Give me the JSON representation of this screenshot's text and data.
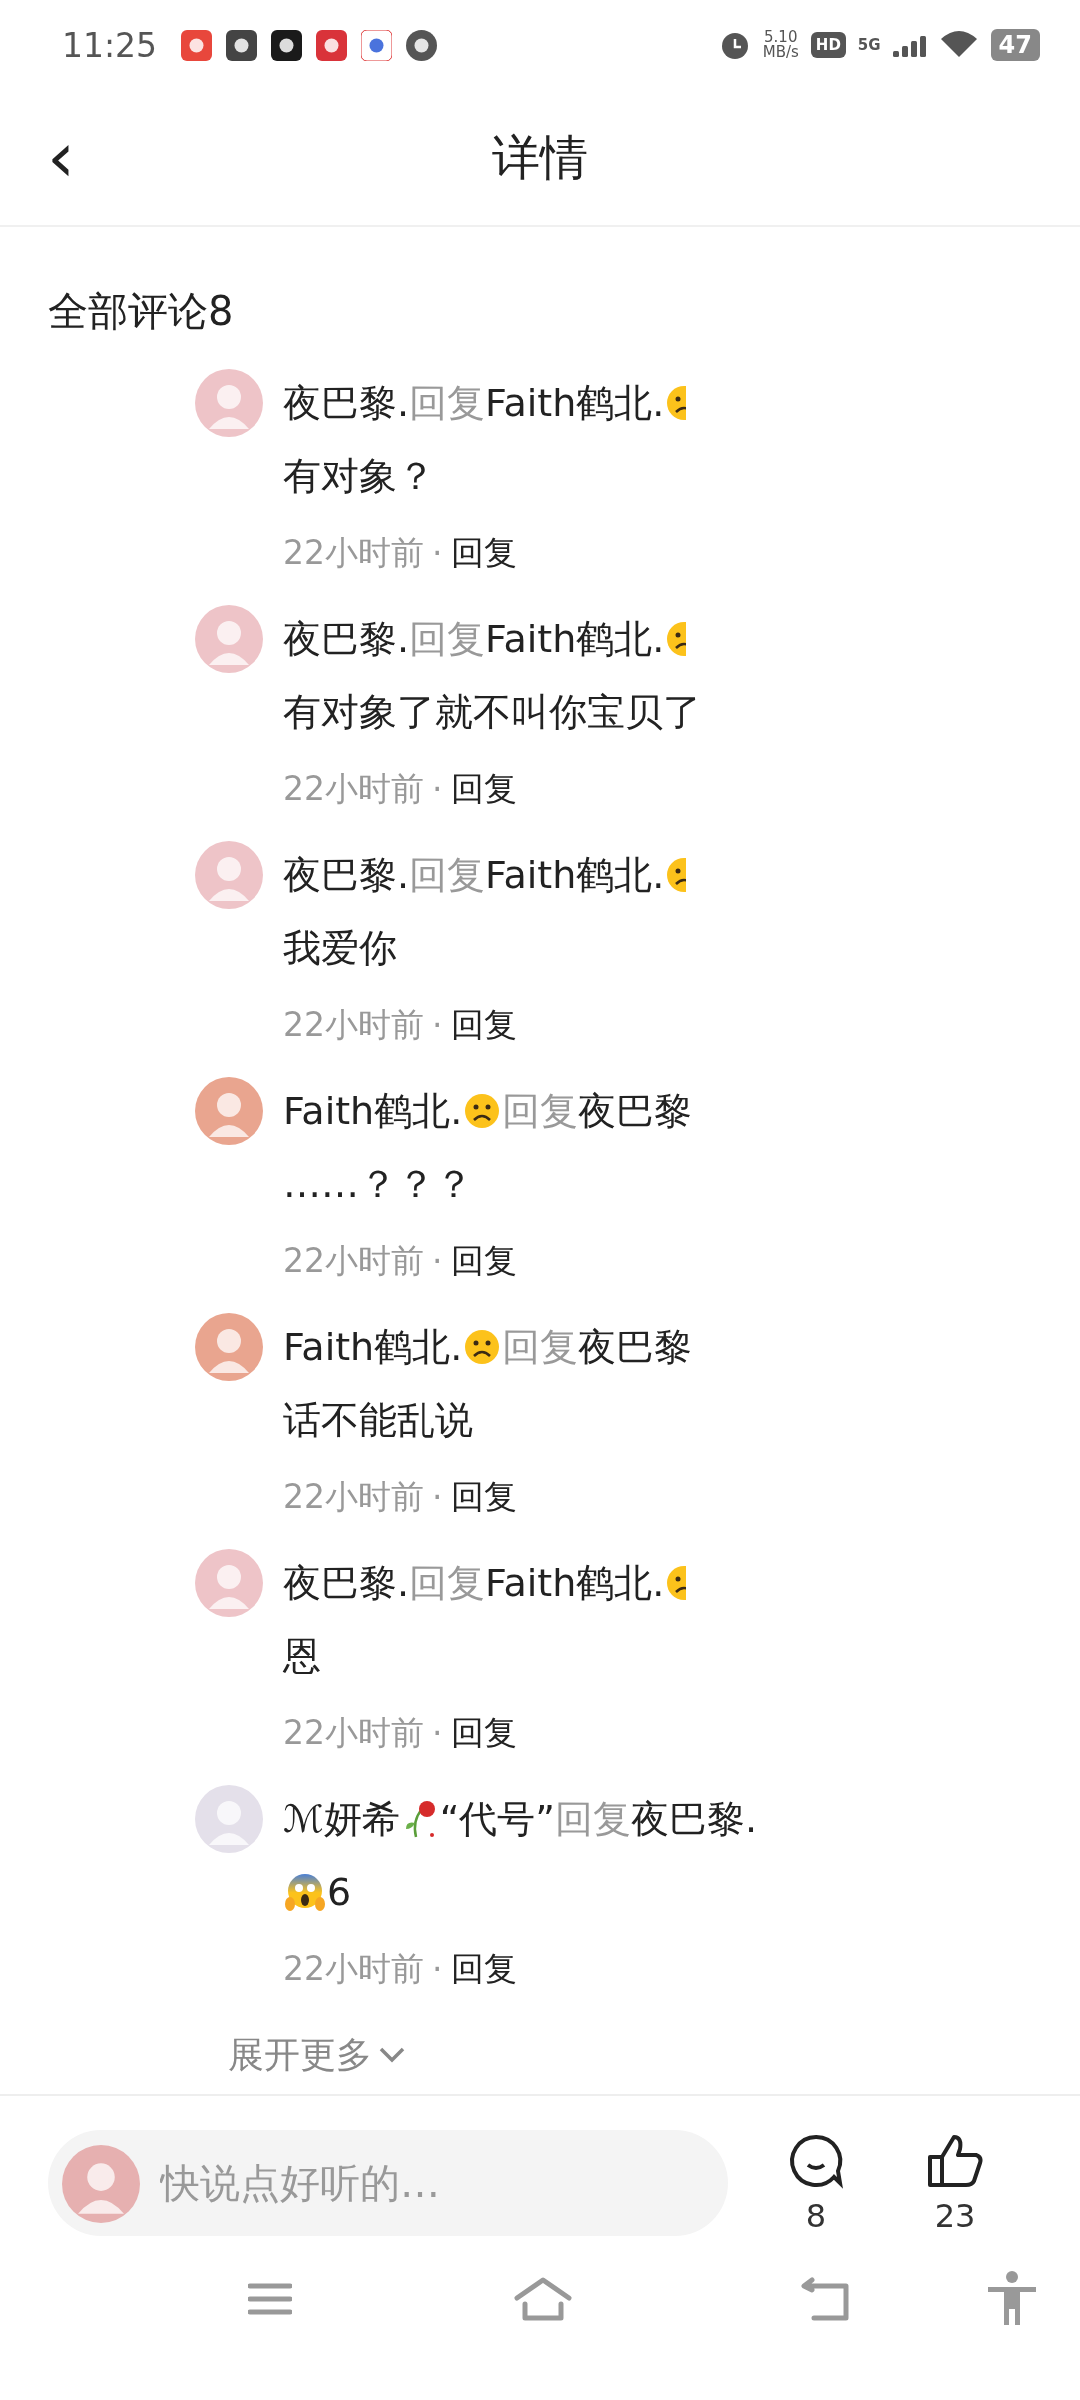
{
  "status_bar": {
    "time": "11:25",
    "speed_value": "5.10",
    "speed_unit": "MB/s",
    "hd": "HD",
    "network": "5G",
    "battery": "47"
  },
  "header": {
    "back": "‹",
    "title": "详情"
  },
  "section_title": "全部评论8",
  "comments": [
    {
      "color": "#eec4c8",
      "name_line": [
        {
          "kind": "name",
          "text": "夜巴黎."
        },
        {
          "kind": "reply",
          "text": "回复"
        },
        {
          "kind": "name",
          "text": "Faith鹤北."
        },
        {
          "kind": "frown-cut"
        }
      ],
      "body": [
        {
          "kind": "name",
          "text": "有对象？"
        }
      ],
      "time": "22小时前",
      "reply": "回复"
    },
    {
      "color": "#eec4c8",
      "name_line": [
        {
          "kind": "name",
          "text": "夜巴黎."
        },
        {
          "kind": "reply",
          "text": "回复"
        },
        {
          "kind": "name",
          "text": "Faith鹤北."
        },
        {
          "kind": "frown-cut"
        }
      ],
      "body": [
        {
          "kind": "name",
          "text": "有对象了就不叫你宝贝了"
        }
      ],
      "time": "22小时前",
      "reply": "回复"
    },
    {
      "color": "#eec4c8",
      "name_line": [
        {
          "kind": "name",
          "text": "夜巴黎."
        },
        {
          "kind": "reply",
          "text": "回复"
        },
        {
          "kind": "name",
          "text": "Faith鹤北."
        },
        {
          "kind": "frown-cut"
        }
      ],
      "body": [
        {
          "kind": "name",
          "text": "我爱你"
        }
      ],
      "time": "22小时前",
      "reply": "回复"
    },
    {
      "color": "#e9a58f",
      "name_line": [
        {
          "kind": "name",
          "text": "Faith鹤北."
        },
        {
          "kind": "frown"
        },
        {
          "kind": "reply",
          "text": "回复"
        },
        {
          "kind": "name",
          "text": "夜巴黎"
        }
      ],
      "body": [
        {
          "kind": "name",
          "text": "……？？？"
        }
      ],
      "time": "22小时前",
      "reply": "回复"
    },
    {
      "color": "#e9a58f",
      "name_line": [
        {
          "kind": "name",
          "text": "Faith鹤北."
        },
        {
          "kind": "frown"
        },
        {
          "kind": "reply",
          "text": "回复"
        },
        {
          "kind": "name",
          "text": "夜巴黎"
        }
      ],
      "body": [
        {
          "kind": "name",
          "text": "话不能乱说"
        }
      ],
      "time": "22小时前",
      "reply": "回复"
    },
    {
      "color": "#eec4c8",
      "name_line": [
        {
          "kind": "name",
          "text": "夜巴黎."
        },
        {
          "kind": "reply",
          "text": "回复"
        },
        {
          "kind": "name",
          "text": "Faith鹤北."
        },
        {
          "kind": "frown-cut"
        }
      ],
      "body": [
        {
          "kind": "name",
          "text": "恩"
        }
      ],
      "time": "22小时前",
      "reply": "回复"
    },
    {
      "color": "#e4e0ea",
      "name_line": [
        {
          "kind": "name",
          "text": "ℳ妍希"
        },
        {
          "kind": "rose"
        },
        {
          "kind": "name",
          "text": "“代号”"
        },
        {
          "kind": "reply",
          "text": "回复"
        },
        {
          "kind": "name",
          "text": "夜巴黎."
        }
      ],
      "body": [
        {
          "kind": "scream"
        },
        {
          "kind": "name",
          "text": "6"
        }
      ],
      "time": "22小时前",
      "reply": "回复"
    }
  ],
  "expand": "展开更多",
  "separator": "·",
  "bottom_bar": {
    "placeholder": "快说点好听的…",
    "comment_count": "8",
    "like_count": "23"
  }
}
